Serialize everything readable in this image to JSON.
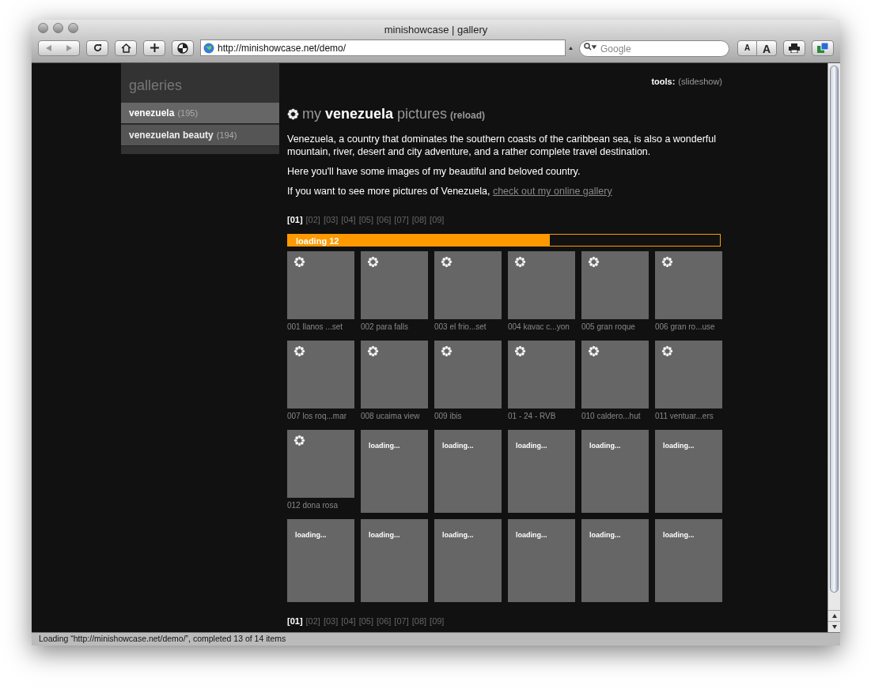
{
  "window": {
    "title": "minishowcase | gallery"
  },
  "toolbar": {
    "url": "http://minishowcase.net/demo/",
    "search_placeholder": "Google",
    "font_smaller": "A",
    "font_larger": "A"
  },
  "sidebar": {
    "title": "galleries",
    "items": [
      {
        "label": "venezuela",
        "count": "(195)",
        "selected": true
      },
      {
        "label": "venezuelan beauty",
        "count": "(194)",
        "selected": false
      }
    ]
  },
  "tools": {
    "label": "tools:",
    "link": "(slideshow)"
  },
  "heading": {
    "prefix": "my",
    "name": "venezuela",
    "suffix": "pictures",
    "reload": "(reload)"
  },
  "paragraphs": [
    "Venezuela, a country that dominates the southern coasts of the caribbean sea, is also a wonderful mountain, river, desert and city adventure, and a rather complete travel destination.",
    "Here you'll have some images of my beautiful and beloved country."
  ],
  "more": {
    "text": "If you want to see more pictures of Venezuela,",
    "link": "check out my online gallery"
  },
  "pages_top": [
    {
      "label": "[01]",
      "selected": true
    },
    {
      "label": "[02]",
      "selected": false
    },
    {
      "label": "[03]",
      "selected": false
    },
    {
      "label": "[04]",
      "selected": false
    },
    {
      "label": "[05]",
      "selected": false
    },
    {
      "label": "[06]",
      "selected": false
    },
    {
      "label": "[07]",
      "selected": false
    },
    {
      "label": "[08]",
      "selected": false
    },
    {
      "label": "[09]",
      "selected": false
    }
  ],
  "progress": {
    "label": "loading 12",
    "level": 0.606
  },
  "thumbnails": [
    {
      "kind": "loaded",
      "caption": "001 llanos ...set"
    },
    {
      "kind": "loaded",
      "caption": "002 para falls"
    },
    {
      "kind": "loaded",
      "caption": "003 el frio...set"
    },
    {
      "kind": "loaded",
      "caption": "004 kavac c...yon"
    },
    {
      "kind": "loaded",
      "caption": "005 gran roque"
    },
    {
      "kind": "loaded",
      "caption": "006 gran ro...use"
    },
    {
      "kind": "loaded",
      "caption": "007 los roq...mar"
    },
    {
      "kind": "loaded",
      "caption": "008 ucaima view"
    },
    {
      "kind": "loaded",
      "caption": "009 ibis"
    },
    {
      "kind": "loaded",
      "caption": "01 - 24 - RVB"
    },
    {
      "kind": "loaded",
      "caption": "010 caldero...hut"
    },
    {
      "kind": "loaded",
      "caption": "011 ventuar...ers"
    },
    {
      "kind": "loaded",
      "caption": "012 dona rosa"
    },
    {
      "kind": "loading",
      "caption": "loading..."
    },
    {
      "kind": "loading",
      "caption": "loading..."
    },
    {
      "kind": "loading",
      "caption": "loading..."
    },
    {
      "kind": "loading",
      "caption": "loading..."
    },
    {
      "kind": "loading",
      "caption": "loading..."
    },
    {
      "kind": "loading",
      "caption": "loading..."
    },
    {
      "kind": "loading",
      "caption": "loading..."
    },
    {
      "kind": "loading",
      "caption": "loading..."
    },
    {
      "kind": "loading",
      "caption": "loading..."
    },
    {
      "kind": "loading",
      "caption": "loading..."
    },
    {
      "kind": "loading",
      "caption": "loading..."
    }
  ],
  "pages_bottom": [
    {
      "label": "[01]",
      "selected": true
    },
    {
      "label": "[02]",
      "selected": false
    },
    {
      "label": "[03]",
      "selected": false
    },
    {
      "label": "[04]",
      "selected": false
    },
    {
      "label": "[05]",
      "selected": false
    },
    {
      "label": "[06]",
      "selected": false
    },
    {
      "label": "[07]",
      "selected": false
    },
    {
      "label": "[08]",
      "selected": false
    },
    {
      "label": "[09]",
      "selected": false
    }
  ],
  "status_bar": "Loading “http://minishowcase.net/demo/”, completed 13 of 14 items"
}
